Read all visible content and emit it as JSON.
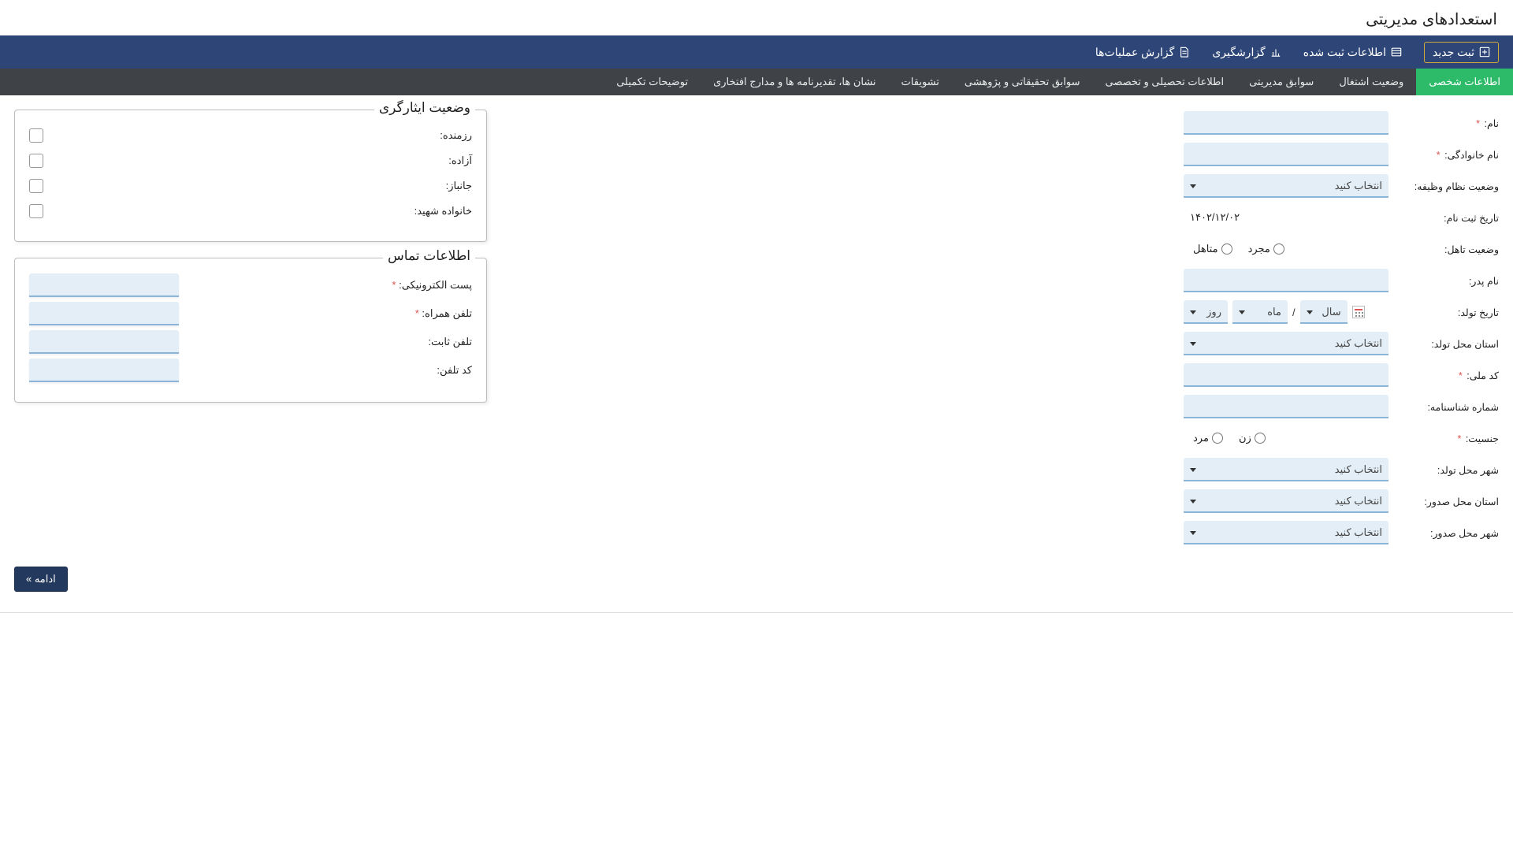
{
  "page_title": "استعدادهای مدیریتی",
  "topbar": {
    "new": "ثبت جدید",
    "registered": "اطلاعات ثبت شده",
    "reporting": "گزارشگیری",
    "oplog": "گزارش عملیات‌ها"
  },
  "tabs": [
    "اطلاعات شخصی",
    "وضعیت اشتغال",
    "سوابق مدیریتی",
    "اطلاعات تحصیلی و تخصصی",
    "سوابق تحقیقاتی و پژوهشی",
    "تشویقات",
    "نشان ها، تقدیرنامه ها و مدارج افتخاری",
    "توضیحات تکمیلی"
  ],
  "labels": {
    "first_name": "نام:",
    "last_name": "نام خانوادگی:",
    "military": "وضعیت نظام وظیفه:",
    "reg_date": "تاریخ ثبت نام:",
    "marital": "وضعیت تاهل:",
    "father": "نام پدر:",
    "dob": "تاریخ تولد:",
    "birth_province": "استان محل تولد:",
    "nid": "کد ملی:",
    "id_no": "شماره شناسنامه:",
    "gender": "جنسیت:",
    "birth_city": "شهر محل تولد:",
    "issue_province": "استان محل صدور:",
    "issue_city": "شهر محل صدور:"
  },
  "placeholders": {
    "select": "انتخاب کنید",
    "day": "روز",
    "month": "ماه",
    "year": "سال"
  },
  "values": {
    "reg_date": "۱۴۰۲/۱۲/۰۲"
  },
  "radios": {
    "married": "متاهل",
    "single": "مجرد",
    "male": "مرد",
    "female": "زن"
  },
  "veteran": {
    "legend": "وضعیت ایثارگری",
    "items": [
      "رزمنده:",
      "آزاده:",
      "جانباز:",
      "خانواده شهید:"
    ]
  },
  "contact": {
    "legend": "اطلاعات تماس",
    "email": "پست الکترونیکی:",
    "mobile": "تلفن همراه:",
    "phone": "تلفن ثابت:",
    "area": "کد تلفن:"
  },
  "continue": "ادامه »"
}
